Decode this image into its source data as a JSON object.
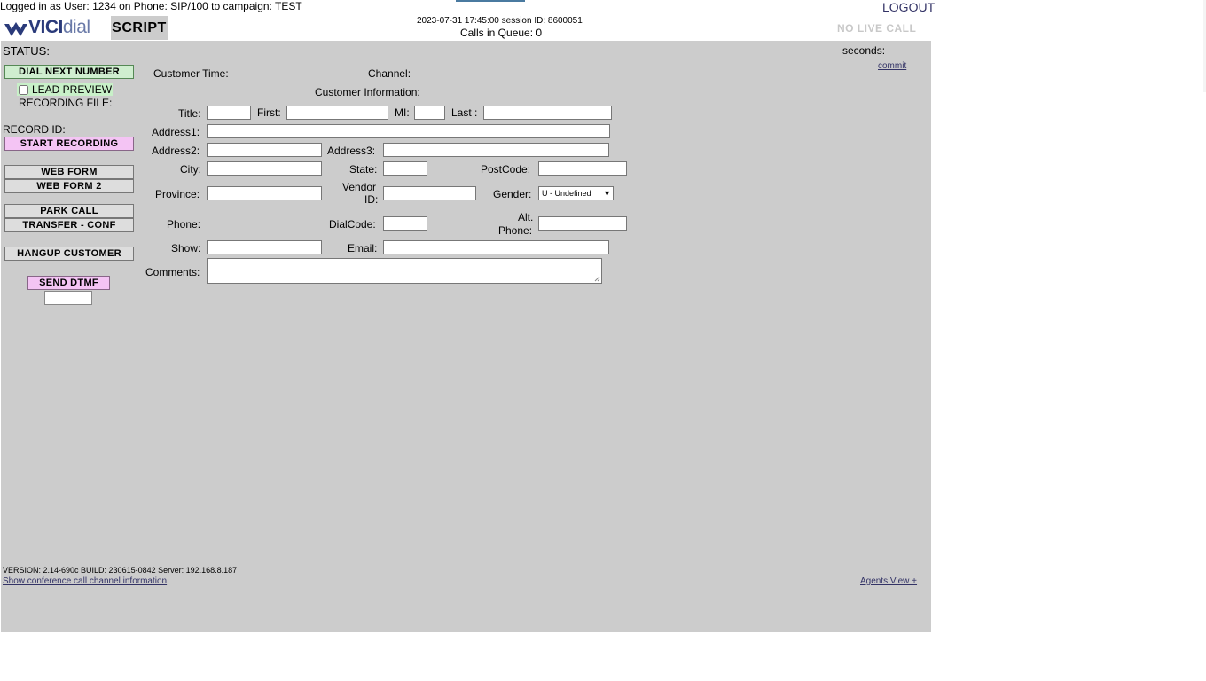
{
  "header": {
    "logged_in": "Logged in as User: 1234 on Phone: SIP/100  to campaign: TEST",
    "logout": "LOGOUT",
    "logo_bold": "VICI",
    "logo_thin": "dial",
    "script_tab": "SCRIPT",
    "datetime": "2023-07-31 17:45:00    session ID: 8600051",
    "queue": "Calls in Queue: 0",
    "no_live_call": "NO LIVE CALL"
  },
  "status": {
    "label": "STATUS:",
    "seconds": "seconds:",
    "commit": "commit"
  },
  "left": {
    "dial_next": "DIAL NEXT NUMBER",
    "lead_preview": "LEAD PREVIEW",
    "recording_file": "RECORDING FILE:",
    "record_id": "RECORD ID:",
    "start_recording": "START RECORDING",
    "web_form": "WEB FORM",
    "web_form_2": "WEB FORM 2",
    "park_call": "PARK CALL",
    "transfer_conf": "TRANSFER - CONF",
    "hangup_customer": "HANGUP CUSTOMER",
    "send_dtmf": "SEND DTMF"
  },
  "form": {
    "customer_time": "Customer Time:",
    "channel": "Channel:",
    "customer_information": "Customer Information:",
    "title": "Title:",
    "first": "First:",
    "mi": "MI:",
    "last": "Last :",
    "address1": "Address1:",
    "address2": "Address2:",
    "address3": "Address3:",
    "city": "City:",
    "state": "State:",
    "postcode": "PostCode:",
    "province": "Province:",
    "vendor": "Vendor",
    "vendor_id": "ID:",
    "gender": "Gender:",
    "gender_value": "U - Undefined",
    "phone": "Phone:",
    "dialcode": "DialCode:",
    "alt": "Alt.",
    "alt_phone": "Phone:",
    "show": "Show:",
    "email": "Email:",
    "comments": "Comments:"
  },
  "footer": {
    "version": "VERSION: 2.14-690c   BUILD: 230615-0842    Server: 192.168.8.187",
    "conf_link": "Show conference call channel information",
    "agents_view": "Agents View +"
  }
}
